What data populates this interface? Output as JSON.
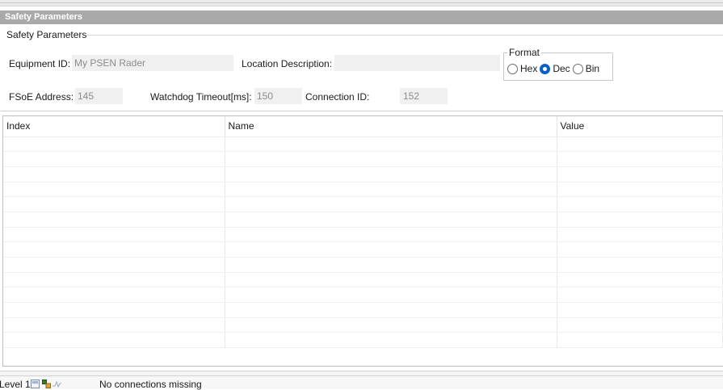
{
  "title_bar": "Safety Parameters",
  "group": {
    "caption": "Safety Parameters",
    "equipment_id_label": "Equipment ID:",
    "equipment_id_value": "My PSEN Rader",
    "location_label": "Location Description:",
    "location_value": "",
    "fsoe_label": "FSoE Address:",
    "fsoe_value": "145",
    "watchdog_label": "Watchdog Timeout[ms]:",
    "watchdog_value": "150",
    "connection_label": "Connection ID:",
    "connection_value": "152"
  },
  "format": {
    "legend": "Format",
    "options": [
      "Hex",
      "Dec",
      "Bin"
    ],
    "selected": "Dec"
  },
  "table": {
    "columns": [
      "Index",
      "Name",
      "Value"
    ],
    "rows": 14
  },
  "status": {
    "level": "Level 1",
    "message": "No connections missing"
  },
  "colors": {
    "title_bar_bg": "#a9a9a9",
    "radio_accent": "#0a61c9"
  }
}
